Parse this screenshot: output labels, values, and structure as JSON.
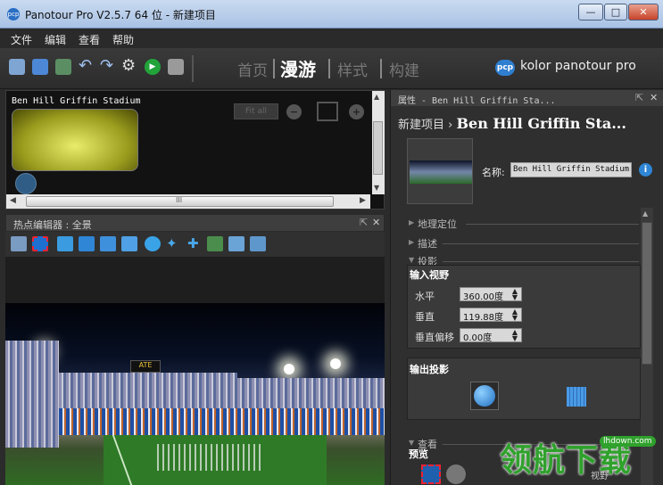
{
  "window": {
    "title": "Panotour Pro V2.5.7 64 位 - 新建项目",
    "app_icon": "pano-icon",
    "controls": {
      "minimize": "—",
      "maximize": "□",
      "close": "✕"
    }
  },
  "menu": {
    "items": [
      "文件",
      "编辑",
      "查看",
      "帮助"
    ]
  },
  "toolbar": {
    "icons": [
      "wizard-icon",
      "save-icon",
      "add-panorama-icon",
      "undo-icon",
      "redo-icon",
      "settings-icon",
      "play-icon",
      "export-icon"
    ],
    "tabs": [
      {
        "label": "首页",
        "active": false
      },
      {
        "label": "漫游",
        "active": true
      },
      {
        "label": "样式",
        "active": false
      },
      {
        "label": "构建",
        "active": false
      }
    ],
    "brand": {
      "logo": "pcp",
      "text": "kolor panotour pro"
    }
  },
  "tour_panel": {
    "panorama_name": "Ben Hill Griffin Stadium",
    "fit_button": "Fit all",
    "zoom_out": "−",
    "zoom_in": "+",
    "hscroll_grip": "III"
  },
  "hotspot_editor": {
    "title": "热点编辑器 : 全景",
    "tools": [
      "select-icon",
      "rect-select-icon",
      "add-polygon-icon",
      "add-image-hotspot-icon",
      "add-point-icon",
      "add-frame-icon",
      "add-spot-icon",
      "add-star-icon",
      "add-plus-icon",
      "fullscreen-icon",
      "image-icon",
      "image-add-icon"
    ],
    "scoreboard": "ATE"
  },
  "properties": {
    "header": "属性 - Ben Hill Griffin Sta...",
    "breadcrumb_root": "新建项目",
    "breadcrumb_sep": "›",
    "breadcrumb_current": "Ben Hill Griffin Sta...",
    "name_label": "名称:",
    "name_value": "Ben Hill Griffin Stadium",
    "sections": {
      "geo": "地理定位",
      "description": "描述",
      "projection": "投影",
      "view": "查看"
    },
    "input_fov": {
      "title": "输入视野",
      "horizontal_label": "水平",
      "horizontal_value": "360.00度",
      "vertical_label": "垂直",
      "vertical_value": "119.88度",
      "offset_label": "垂直偏移",
      "offset_value": "0.00度"
    },
    "output_projection": {
      "title": "输出投影"
    },
    "preview": {
      "title": "预览",
      "view_label": "视野"
    }
  },
  "watermark": {
    "text": "领航下载",
    "site": "lhdown.com"
  }
}
